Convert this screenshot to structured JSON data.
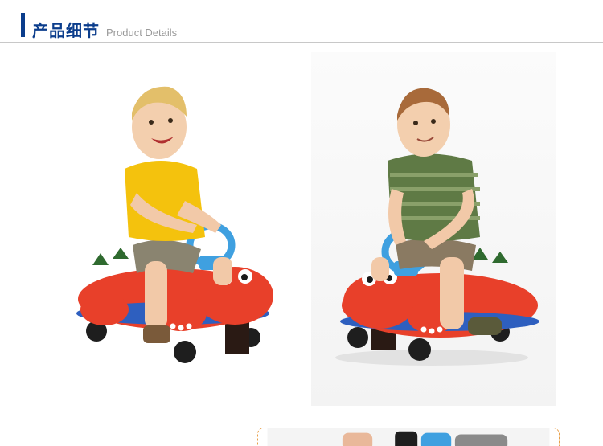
{
  "header": {
    "title": "产品细节",
    "subtitle": "Product Details",
    "accent_color": "#0b3d8c"
  },
  "photos": [
    {
      "alt": "child-in-yellow-shirt-riding-red-dinosaur-toy",
      "shirt_color": "#f4c20d",
      "toy_color": "#e8402a"
    },
    {
      "alt": "child-in-striped-shirt-riding-red-dinosaur-toy",
      "shirt_color": "#5f7a45",
      "toy_color": "#e8402a"
    }
  ],
  "bottom_photo": {
    "alt": "cropped-product-detail-photo",
    "border_color": "#e8a04a"
  }
}
